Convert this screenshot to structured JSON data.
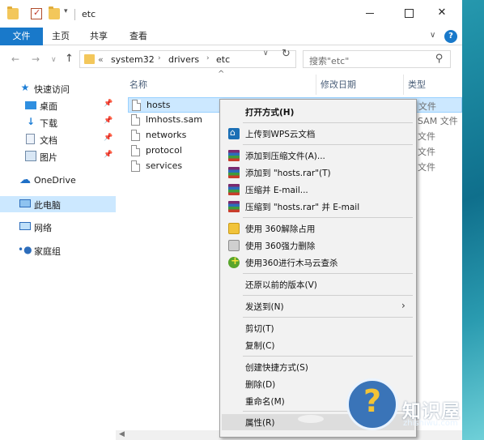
{
  "window": {
    "title": "etc"
  },
  "ribbon": {
    "file": "文件",
    "tabs": [
      "主页",
      "共享",
      "查看"
    ]
  },
  "address": {
    "prefix": "«",
    "crumbs": [
      "system32",
      "drivers",
      "etc"
    ]
  },
  "search": {
    "placeholder": "搜索\"etc\""
  },
  "sidebar": {
    "items": [
      {
        "label": "快速访问",
        "icon": "star-icon"
      },
      {
        "label": "桌面",
        "icon": "desktop-icon",
        "pinned": true
      },
      {
        "label": "下载",
        "icon": "download-icon",
        "pinned": true
      },
      {
        "label": "文档",
        "icon": "document-icon",
        "pinned": true
      },
      {
        "label": "图片",
        "icon": "picture-icon",
        "pinned": true
      },
      {
        "label": "OneDrive",
        "icon": "cloud-icon"
      },
      {
        "label": "此电脑",
        "icon": "computer-icon",
        "selected": true
      },
      {
        "label": "网络",
        "icon": "network-icon"
      },
      {
        "label": "家庭组",
        "icon": "homegroup-icon"
      }
    ]
  },
  "columns": {
    "name": "名称",
    "modified": "修改日期",
    "type": "类型"
  },
  "files": [
    {
      "name": "hosts",
      "type": "文件",
      "selected": true
    },
    {
      "name": "lmhosts.sam",
      "type": "SAM 文件"
    },
    {
      "name": "networks",
      "type": "文件"
    },
    {
      "name": "protocol",
      "type": "文件"
    },
    {
      "name": "services",
      "type": "文件"
    }
  ],
  "context_menu": {
    "items": [
      {
        "label": "打开方式(H)",
        "bold": true
      },
      {
        "label": "上传到WPS云文档",
        "icon": "wps-cloud-icon"
      },
      {
        "label": "添加到压缩文件(A)...",
        "icon": "winrar-icon"
      },
      {
        "label": "添加到 \"hosts.rar\"(T)",
        "icon": "winrar-icon"
      },
      {
        "label": "压缩并 E-mail...",
        "icon": "winrar-icon"
      },
      {
        "label": "压缩到 \"hosts.rar\" 并 E-mail",
        "icon": "winrar-icon"
      },
      {
        "label": "使用 360解除占用",
        "icon": "unlock-360-icon"
      },
      {
        "label": "使用 360强力删除",
        "icon": "shred-360-icon"
      },
      {
        "label": "使用360进行木马云查杀",
        "icon": "scan-360-icon"
      },
      {
        "label": "还原以前的版本(V)"
      },
      {
        "label": "发送到(N)",
        "submenu": true
      },
      {
        "label": "剪切(T)"
      },
      {
        "label": "复制(C)"
      },
      {
        "label": "创建快捷方式(S)"
      },
      {
        "label": "删除(D)"
      },
      {
        "label": "重命名(M)"
      },
      {
        "label": "属性(R)",
        "hover": true
      }
    ]
  },
  "watermark": {
    "brand": "知识屋",
    "url": "zhishiwu.com"
  },
  "colors": {
    "accent": "#1979ca",
    "selection": "#cce8ff"
  }
}
